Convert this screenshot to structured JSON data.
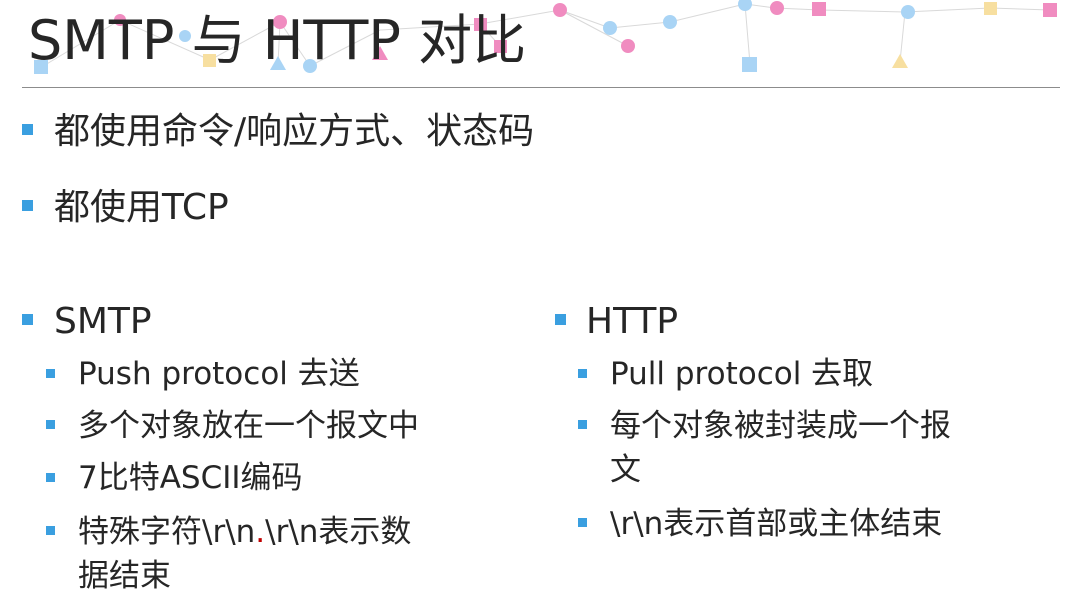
{
  "slide": {
    "title": "SMTP 与 HTTP 对比",
    "bullets_top": [
      "都使用命令/响应方式、状态码",
      "都使用TCP"
    ],
    "smtp": {
      "heading": "SMTP",
      "items": [
        "Push protocol 去送",
        "多个对象放在一个报文中",
        "7比特ASCII编码"
      ],
      "item4_part1": "特殊字符\\r\\n",
      "item4_dot": ".",
      "item4_part2": "\\r\\n表示数",
      "item4_line2": "据结束"
    },
    "http": {
      "heading": "HTTP",
      "items": [
        "Pull protocol 去取"
      ],
      "item2_line1": "每个对象被封装成一个报",
      "item2_line2": "文",
      "item3": "\\r\\n表示首部或主体结束"
    }
  },
  "colors": {
    "bullet": "#3a9fe0",
    "text": "#262626",
    "accent_dot": "#c00000",
    "decor_blue": "#a9d4f5",
    "decor_pink": "#f08cc0",
    "decor_yellow": "#f7dfa0"
  }
}
